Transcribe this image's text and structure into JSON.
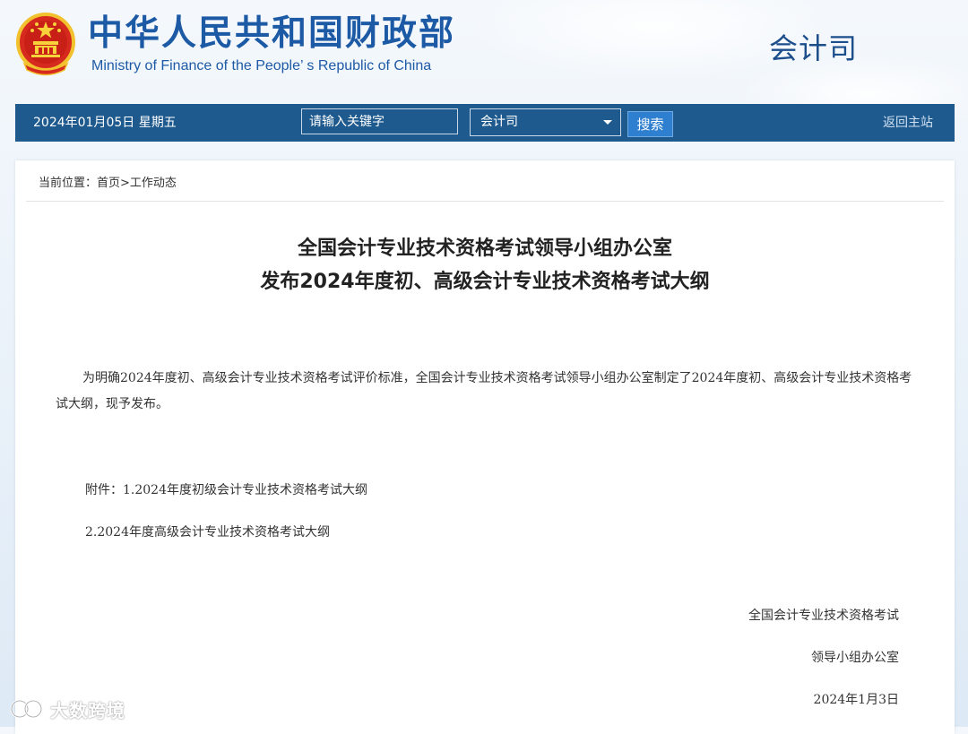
{
  "header": {
    "title_cn": "中华人民共和国财政部",
    "title_en": "Ministry of Finance of the People’ s Republic of China",
    "department": "会计司",
    "emblem_icon": "national-emblem-icon"
  },
  "navbar": {
    "date": "2024年01月05日  星期五",
    "search_placeholder": "请输入关键字",
    "scope_selected": "会计司",
    "search_button": "搜索",
    "home_link": "返回主站"
  },
  "breadcrumb": "当前位置：首页>工作动态",
  "article": {
    "title_line1": "全国会计专业技术资格考试领导小组办公室",
    "title_line2": "发布2024年度初、高级会计专业技术资格考试大纲",
    "body": "为明确2024年度初、高级会计专业技术资格考试评价标准，全国会计专业技术资格考试领导小组办公室制定了2024年度初、高级会计专业技术资格考试大纲，现予发布。",
    "attachments": [
      "附件：1.2024年度初级会计专业技术资格考试大纲",
      "2.2024年度高级会计专业技术资格考试大纲"
    ],
    "signature_line1": "全国会计专业技术资格考试",
    "signature_line2": "领导小组办公室",
    "date": "2024年1月3日"
  },
  "watermark": {
    "text": "大数跨境",
    "icon": "brand-logo-icon"
  },
  "colors": {
    "brand_blue": "#1d5aa5",
    "nav_bg": "#1f5a8e",
    "search_button": "#2e7fd0"
  }
}
